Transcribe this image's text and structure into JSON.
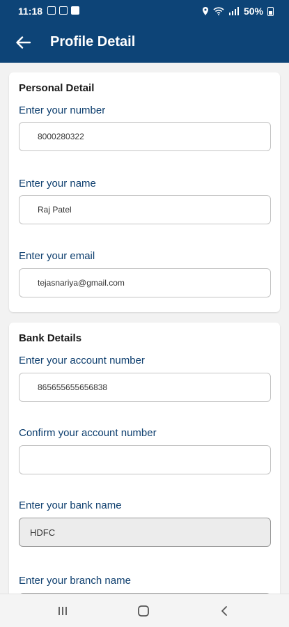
{
  "status_bar": {
    "time": "11:18",
    "battery": "50%"
  },
  "header": {
    "title": "Profile Detail",
    "back_icon": "arrow-left-icon"
  },
  "personal": {
    "section_title": "Personal Detail",
    "number_label": "Enter your number",
    "number_value": "8000280322",
    "name_label": "Enter your name",
    "name_value": "Raj Patel",
    "email_label": "Enter your email",
    "email_value": "tejasnariya@gmail.com"
  },
  "bank": {
    "section_title": "Bank Details",
    "account_label": "Enter your account number",
    "account_value": "865655655656838",
    "confirm_label": "Confirm your account number",
    "confirm_value": "",
    "bank_label": "Enter your bank name",
    "bank_value": "HDFC",
    "branch_label": "Enter your branch name"
  },
  "colors": {
    "primary": "#0d4477",
    "label": "#0d3e6e"
  }
}
